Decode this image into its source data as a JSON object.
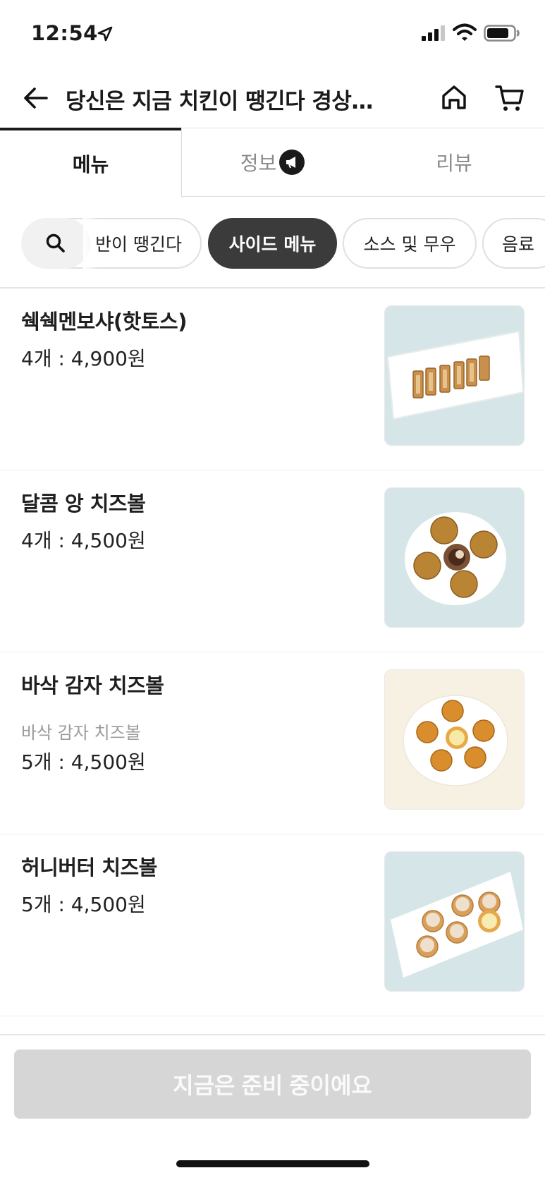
{
  "status_bar": {
    "time": "12:54"
  },
  "header": {
    "title": "당신은 지금 치킨이 땡긴다 경상…"
  },
  "tabs": [
    {
      "label": "메뉴",
      "active": true
    },
    {
      "label": "정보",
      "active": false
    },
    {
      "label": "리뷰",
      "active": false
    }
  ],
  "categories": [
    {
      "label": "반이 땡긴다",
      "active": false
    },
    {
      "label": "사이드 메뉴",
      "active": true
    },
    {
      "label": "소스 및 무우",
      "active": false
    },
    {
      "label": "음료",
      "active": false
    }
  ],
  "menu_items": [
    {
      "name": "쉑쉑멘보샤(핫토스)",
      "description": "",
      "price": "4개 : 4,900원",
      "image": "menbosha-plate",
      "bg_color": "#d6e6e8"
    },
    {
      "name": "달콤 앙 치즈볼",
      "description": "",
      "price": "4개 : 4,500원",
      "image": "sweet-cheeseball-plate",
      "bg_color": "#d6e6e8"
    },
    {
      "name": "바삭 감자 치즈볼",
      "description": "바삭 감자 치즈볼",
      "price": "5개 : 4,500원",
      "image": "potato-cheeseball-plate",
      "bg_color": "#f6f1e2"
    },
    {
      "name": "허니버터 치즈볼",
      "description": "",
      "price": "5개 : 4,500원",
      "image": "honeybutter-cheeseball-plate",
      "bg_color": "#d6e6e8"
    }
  ],
  "bottom": {
    "order_label": "지금은 준비 중이에요"
  },
  "colors": {
    "active_chip": "#3b3b3b",
    "disabled_button": "#d6d6d6",
    "text_primary": "#1a1a1a"
  }
}
